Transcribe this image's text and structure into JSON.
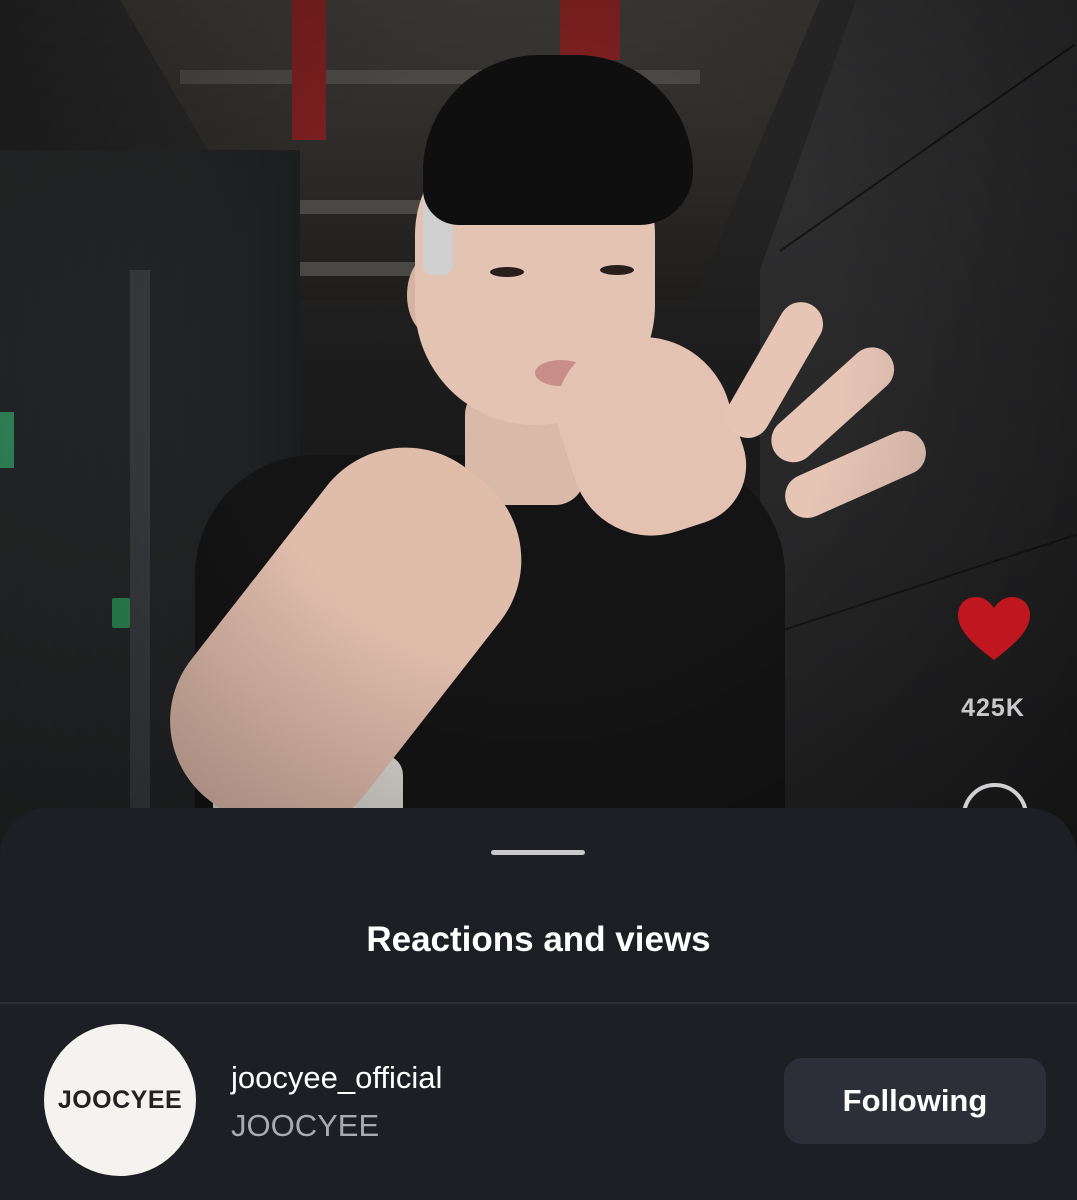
{
  "video": {
    "like_icon": "heart-icon",
    "like_count": "425K",
    "like_color": "#c0161f",
    "comment_icon": "comment-icon"
  },
  "sheet": {
    "title": "Reactions and views"
  },
  "account": {
    "avatar_text": "JOOCYEE",
    "username": "joocyee_official",
    "display_name": "JOOCYEE",
    "follow_label": "Following"
  },
  "colors": {
    "sheet_bg": "#1d1f25",
    "button_bg": "#2c2f37",
    "secondary_text": "#a9abb2"
  }
}
